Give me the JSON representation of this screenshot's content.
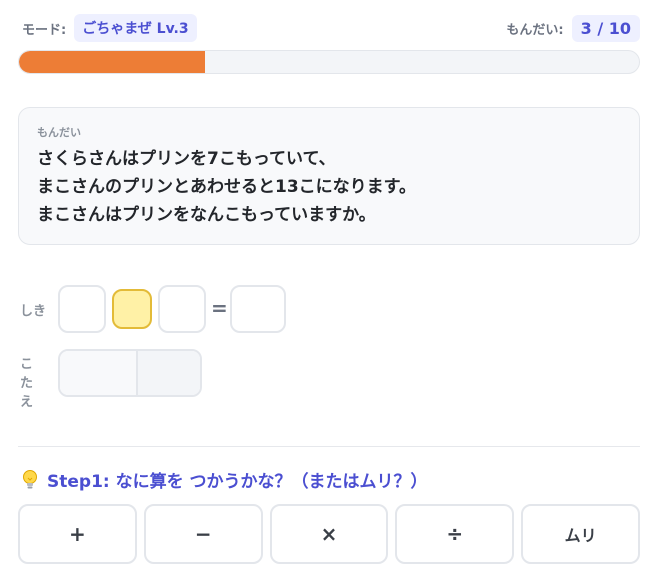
{
  "header": {
    "mode_label": "モード:",
    "mode_value": "ごちゃまぜ Lv.3",
    "count_label": "もんだい:",
    "count_value": "3 / 10"
  },
  "progress": {
    "fraction": 0.3,
    "color": "#ed7d36"
  },
  "question": {
    "label": "もんだい",
    "lines": [
      "さくらさんはプリンを7こもっていて、",
      "まこさんのプリンとあわせると13こになります。",
      "まこさんはプリンをなんこもっていますか。"
    ]
  },
  "formula": {
    "label": "しき",
    "equals": "="
  },
  "answer": {
    "label": "こたえ"
  },
  "step": {
    "icon": "lightbulb-icon",
    "text": "Step1: なに算を つかうかな？（またはムリ？）"
  },
  "operators": [
    "+",
    "−",
    "×",
    "÷",
    "ムリ"
  ],
  "colors": {
    "accent": "#4b4fd1",
    "progress": "#ed7d36",
    "active_box": "#fff1a6"
  }
}
